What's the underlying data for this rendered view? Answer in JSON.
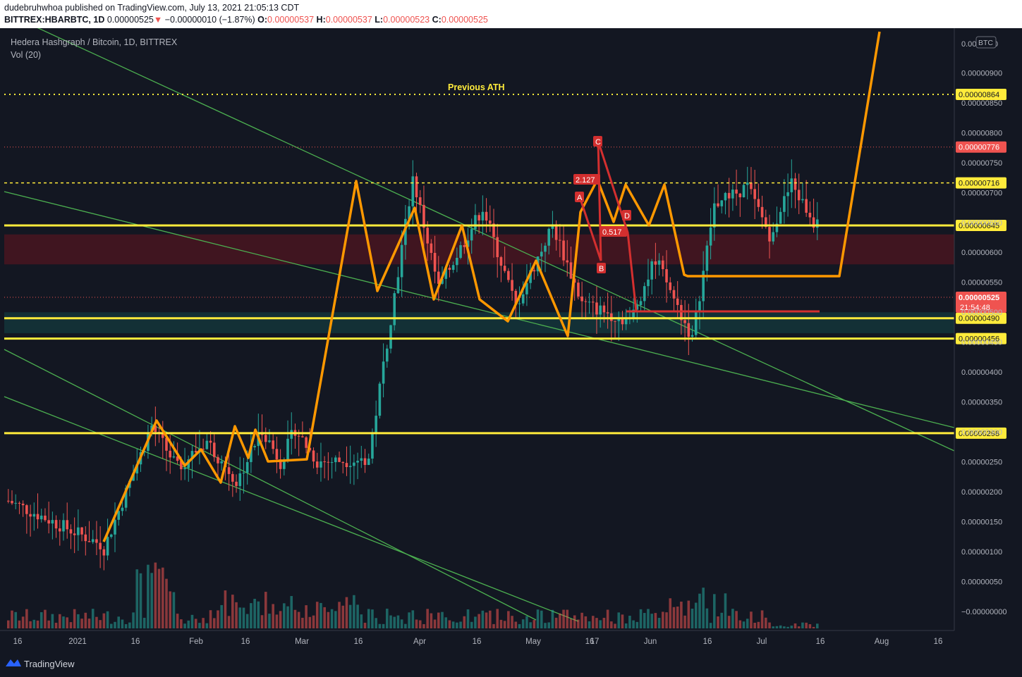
{
  "header": {
    "published": "dudebruhwhoa published on TradingView.com, July 13, 2021 21:05:13 CDT",
    "symbol": "BITTREX:HBARBTC, 1D",
    "last": "0.00000525",
    "change": "−0.00000010 (−1.87%)",
    "o_label": "O:",
    "o": "0.00000537",
    "h_label": "H:",
    "h": "0.00000537",
    "l_label": "L:",
    "l": "0.00000523",
    "c_label": "C:",
    "c": "0.00000525"
  },
  "legend": {
    "title": "Hedera Hashgraph / Bitcoin, 1D, BITTREX",
    "vol": "Vol (20)",
    "currency": "BTC"
  },
  "annotations": {
    "previous_ath": "Previous ATH",
    "pattern_points": [
      "A",
      "B",
      "C",
      "D"
    ],
    "fib_1": "2.127",
    "fib_2": "0.517"
  },
  "footer": {
    "brand": "TradingView"
  },
  "colors": {
    "background": "#131722",
    "up": "#26a69a",
    "down": "#ef5350",
    "yellow": "#ffeb3b",
    "orange": "#ff9800",
    "green_line": "#4caf50",
    "red_pattern": "#d32f2f"
  },
  "chart_data": {
    "type": "candlestick",
    "y_axis": {
      "ticks": [
        "0.00000050",
        "0.00000100",
        "0.00000150",
        "0.00000200",
        "0.00000250",
        "0.00000300",
        "0.00000350",
        "0.00000400",
        "0.00000450",
        "0.00000500",
        "0.00000550",
        "0.00000600",
        "0.00000650",
        "0.00000700",
        "0.00000750",
        "0.00000800",
        "0.00000850",
        "0.00000900",
        "−0.00000000"
      ],
      "top_label": "0.0000950",
      "range": [
        -5e-08,
        9.55e-06
      ]
    },
    "x_axis": {
      "ticks": [
        "16",
        "2021",
        "16",
        "Feb",
        "16",
        "Mar",
        "16",
        "Apr",
        "16",
        "May",
        "16",
        "17",
        "Jun",
        "16",
        "Jul",
        "16",
        "Aug",
        "16"
      ]
    },
    "horizontal_levels": [
      {
        "value": "0.00000864",
        "style": "dotted",
        "label": "0.00000864"
      },
      {
        "value": "0.00000776",
        "style": "dotted-red",
        "label": "0.00000776"
      },
      {
        "value": "0.00000716",
        "style": "dashed",
        "label": "0.00000716"
      },
      {
        "value": "0.00000645",
        "style": "solid",
        "label": "0.00000645"
      },
      {
        "value": "0.00000490",
        "style": "solid",
        "label": "0.00000490"
      },
      {
        "value": "0.00000456",
        "style": "solid",
        "label": "0.00000456"
      },
      {
        "value": "0.00000298",
        "style": "solid",
        "label": "0.00000298"
      }
    ],
    "current_price": {
      "value": "0.00000525",
      "countdown": "21:54:48"
    },
    "zones": [
      {
        "name": "resistance",
        "from": 5.8e-06,
        "to": 6.3e-06
      },
      {
        "name": "support",
        "from": 4.65e-06,
        "to": 5e-06
      }
    ],
    "orange_path": [
      [
        0,
        1.05e-06
      ],
      [
        13,
        3.1e-06
      ],
      [
        20,
        2.4e-06
      ],
      [
        28,
        2.85e-06
      ],
      [
        36,
        2.15e-06
      ],
      [
        43,
        3.05e-06
      ],
      [
        48,
        2.5e-06
      ],
      [
        52,
        3.05e-06
      ],
      [
        58,
        2.5e-06
      ],
      [
        72,
        2.55e-06
      ],
      [
        84,
        7.25e-06
      ],
      [
        91,
        5.4e-06
      ],
      [
        103,
        6.75e-06
      ],
      [
        112,
        5.1e-06
      ],
      [
        122,
        6.45e-06
      ],
      [
        130,
        5.15e-06
      ],
      [
        143,
        4.85e-06
      ],
      [
        150,
        5.9e-06
      ],
      [
        160,
        4.55e-06
      ],
      [
        166,
        6.8e-06
      ],
      [
        175,
        7.1e-06
      ],
      [
        181,
        6.3e-06
      ],
      [
        187,
        7.15e-06
      ],
      [
        193,
        6.5e-06
      ],
      [
        198,
        7.15e-06
      ],
      [
        203,
        6.4e-06
      ],
      [
        208,
        5.6e-06
      ],
      [
        243,
        5.6e-06
      ],
      [
        250,
        6.45e-06
      ],
      [
        263,
        9.5e-06
      ]
    ],
    "red_pattern": [
      [
        165,
        6.8e-06
      ],
      [
        173,
        5.95e-06
      ],
      [
        178,
        7.9e-06
      ],
      [
        186,
        5.9e-06
      ],
      [
        193,
        5e-06
      ]
    ],
    "volume_ma": "Vol (20)"
  }
}
